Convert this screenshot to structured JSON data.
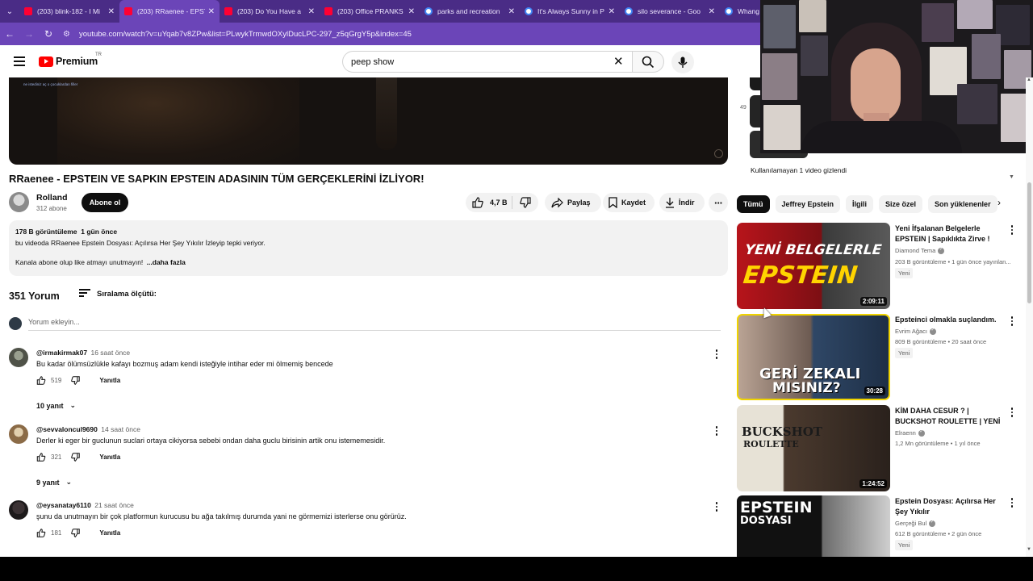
{
  "browser": {
    "tabs": [
      {
        "title": "(203) blink-182 - I Mi",
        "favicon": "youtube",
        "active": false
      },
      {
        "title": "(203) RRaenee - EPST",
        "favicon": "youtube",
        "active": true
      },
      {
        "title": "(203) Do You Have a",
        "favicon": "youtube",
        "active": false
      },
      {
        "title": "(203) Office PRANKS",
        "favicon": "youtube",
        "active": false
      },
      {
        "title": "parks and recreation",
        "favicon": "google",
        "active": false
      },
      {
        "title": "It's Always Sunny in P",
        "favicon": "google",
        "active": false
      },
      {
        "title": "silo severance - Goo",
        "favicon": "google",
        "active": false
      },
      {
        "title": "Whang",
        "favicon": "google",
        "active": false
      }
    ],
    "url": "youtube.com/watch?v=uYqab7v8ZPw&list=PLwykTrmwdOXylDucLPC-297_z5qGrgY5p&index=45"
  },
  "header": {
    "logo_text": "Premium",
    "region": "TR",
    "search_value": "peep show"
  },
  "video": {
    "title": "RRaenee - EPSTEIN VE SAPKIN EPSTEIN ADASININ TÜM GERÇEKLERİNİ İZLİYOR!",
    "overlay_caption": "ne istediniz aç o çocuklardan filler",
    "channel": "Rolland",
    "subscribers": "312 abone",
    "subscribe_label": "Abone ol",
    "likes": "4,7 B",
    "share_label": "Paylaş",
    "save_label": "Kaydet",
    "download_label": "İndir",
    "views": "178 B görüntüleme",
    "age": "1 gün önce",
    "description_line1": "bu videoda RRaenee Epstein Dosyası: Açılırsa Her Şey Yıkılır İzleyip tepki veriyor.",
    "description_line2": "Kanala abone olup like atmayı unutmayın!",
    "more_label": "...daha fazla"
  },
  "comments": {
    "count_label": "351 Yorum",
    "sort_label": "Sıralama ölçütü:",
    "add_placeholder": "Yorum ekleyin...",
    "reply_label": "Yanıtla",
    "items": [
      {
        "user": "@irmakirmak07",
        "time": "16 saat önce",
        "text": "Bu kadar ölümsüzlükle kafayı bozmuş adam kendi isteğiyle intihar eder mi ölmemiş bencede",
        "likes": "519",
        "replies": "10 yanıt"
      },
      {
        "user": "@sevvaloncul9690",
        "time": "14 saat önce",
        "text": "Derler ki eger bir guclunun suclari ortaya cikiyorsa sebebi ondan daha guclu birisinin artik onu istememesidir.",
        "likes": "321",
        "replies": "9 yanıt"
      },
      {
        "user": "@eysanatay6110",
        "time": "21 saat önce",
        "text": "şunu da unutmayın bir çok platformun kurucusu bu ağa takılmış durumda yani ne görmemizi isterlerse onu görürüz.",
        "likes": "181",
        "replies": ""
      }
    ]
  },
  "sidebar": {
    "playlist_index": "49",
    "hidden_note": "Kullanılamayan 1 video gizlendi",
    "chips": [
      "Tümü",
      "Jeffrey Epstein",
      "İlgili",
      "Size özel",
      "Son yüklenenler"
    ],
    "recommendations": [
      {
        "title": "Yeni İfşalanan Belgelerle EPSTEIN | Sapıklıkta Zirve !",
        "channel": "Diamond Tema",
        "stats": "203 B görüntüleme • 1 gün önce yayınlan...",
        "badge": "Yeni",
        "duration": "2:09:11",
        "thumb_text_1": "YENİ BELGELERLE",
        "thumb_text_2": "EPSTEIN"
      },
      {
        "title": "Epsteinci olmakla suçlandım.",
        "channel": "Evrim Ağacı",
        "stats": "809 B görüntüleme • 20 saat önce",
        "badge": "Yeni",
        "duration": "30:28",
        "thumb_text_1": "GERİ ZEKALI",
        "thumb_text_2": "MISINIZ?"
      },
      {
        "title": "KİM DAHA CESUR ? | BUCKSHOT ROULETTE | YENİ ...",
        "channel": "Elraenn",
        "stats": "1,2 Mn görüntüleme • 1 yıl önce",
        "badge": "",
        "duration": "1:24:52",
        "thumb_text_1": "BUCKSHOT",
        "thumb_text_2": "ROULETTE"
      },
      {
        "title": "Epstein Dosyası: Açılırsa Her Şey Yıkılır",
        "channel": "Gerçeği Bul",
        "stats": "612 B görüntüleme • 2 gün önce",
        "badge": "Yeni",
        "duration": "",
        "thumb_text_1": "EPSTEIN",
        "thumb_text_2": "DOSYASI"
      }
    ]
  },
  "colors": {
    "accent": "#ff0000",
    "browser_frame": "#6b45b8",
    "tab_strip": "#4a2c86"
  }
}
